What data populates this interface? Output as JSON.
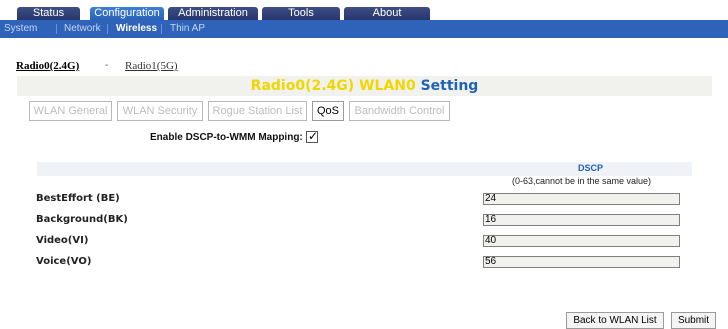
{
  "topnav": {
    "tabs": [
      {
        "label": "Status",
        "active": false
      },
      {
        "label": "Configuration",
        "active": true
      },
      {
        "label": "Administration",
        "active": false
      },
      {
        "label": "Tools",
        "active": false
      },
      {
        "label": "About",
        "active": false
      }
    ]
  },
  "subnav": {
    "items": [
      {
        "label": "System",
        "active": false
      },
      {
        "label": "Network",
        "active": false
      },
      {
        "label": "Wireless",
        "active": true
      },
      {
        "label": "Thin AP",
        "active": false
      }
    ]
  },
  "radios": {
    "radio0": "Radio0(2.4G)",
    "separator": "-",
    "radio1": "Radio1(5G)"
  },
  "title": {
    "part1": "Radio0(2.4G) WLAN0",
    "part2": "Setting"
  },
  "subtabs": [
    {
      "label": "WLAN General",
      "active": false
    },
    {
      "label": "WLAN Security",
      "active": false
    },
    {
      "label": "Rogue Station List",
      "active": false
    },
    {
      "label": "QoS",
      "active": true
    },
    {
      "label": "Bandwidth Control",
      "active": false
    }
  ],
  "dscp_mapping": {
    "label": "Enable DSCP-to-WMM Mapping:",
    "checked": true
  },
  "table": {
    "header": "DSCP",
    "note": "(0-63,cannot be in the same value)",
    "rows": [
      {
        "label": "BestEffort (BE)",
        "value": "24"
      },
      {
        "label": "Background(BK)",
        "value": "16"
      },
      {
        "label": "Video(VI)",
        "value": "40"
      },
      {
        "label": "Voice(VO)",
        "value": "56"
      }
    ]
  },
  "buttons": {
    "back": "Back to WLAN List",
    "submit": "Submit"
  }
}
